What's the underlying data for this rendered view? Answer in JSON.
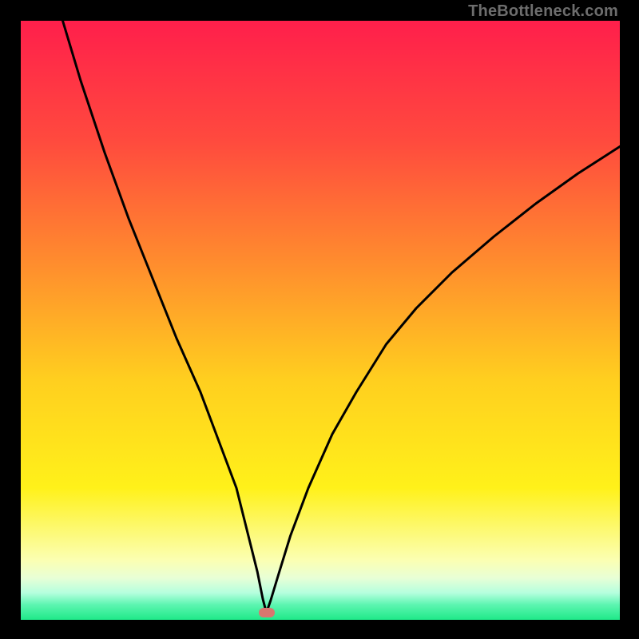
{
  "watermark": {
    "text": "TheBottleneck.com"
  },
  "chart_data": {
    "type": "line",
    "title": "",
    "xlabel": "",
    "ylabel": "",
    "xlim": [
      0,
      100
    ],
    "ylim": [
      0,
      100
    ],
    "grid": false,
    "legend": null,
    "background_gradient": [
      {
        "stop": 0.0,
        "color": "#ff1f4b"
      },
      {
        "stop": 0.2,
        "color": "#ff4a3e"
      },
      {
        "stop": 0.4,
        "color": "#ff8b2e"
      },
      {
        "stop": 0.6,
        "color": "#ffcf1f"
      },
      {
        "stop": 0.78,
        "color": "#fff11a"
      },
      {
        "stop": 0.9,
        "color": "#fbffb2"
      },
      {
        "stop": 0.93,
        "color": "#e8ffd6"
      },
      {
        "stop": 0.955,
        "color": "#b5ffde"
      },
      {
        "stop": 0.975,
        "color": "#5cf5b0"
      },
      {
        "stop": 1.0,
        "color": "#1fe989"
      }
    ],
    "marker": {
      "x": 41,
      "y": 1.2,
      "color": "#d9766f"
    },
    "series": [
      {
        "name": "curve",
        "color": "#000000",
        "x": [
          7,
          10,
          14,
          18,
          22,
          26,
          30,
          33,
          36,
          38,
          39.5,
          40.4,
          41,
          41.7,
          43,
          45,
          48,
          52,
          56,
          61,
          66,
          72,
          79,
          86,
          93,
          100
        ],
        "y": [
          100,
          90,
          78,
          67,
          57,
          47,
          38,
          30,
          22,
          14,
          8,
          3.5,
          1.2,
          3.2,
          7.5,
          14,
          22,
          31,
          38,
          46,
          52,
          58,
          64,
          69.5,
          74.5,
          79
        ]
      }
    ]
  }
}
